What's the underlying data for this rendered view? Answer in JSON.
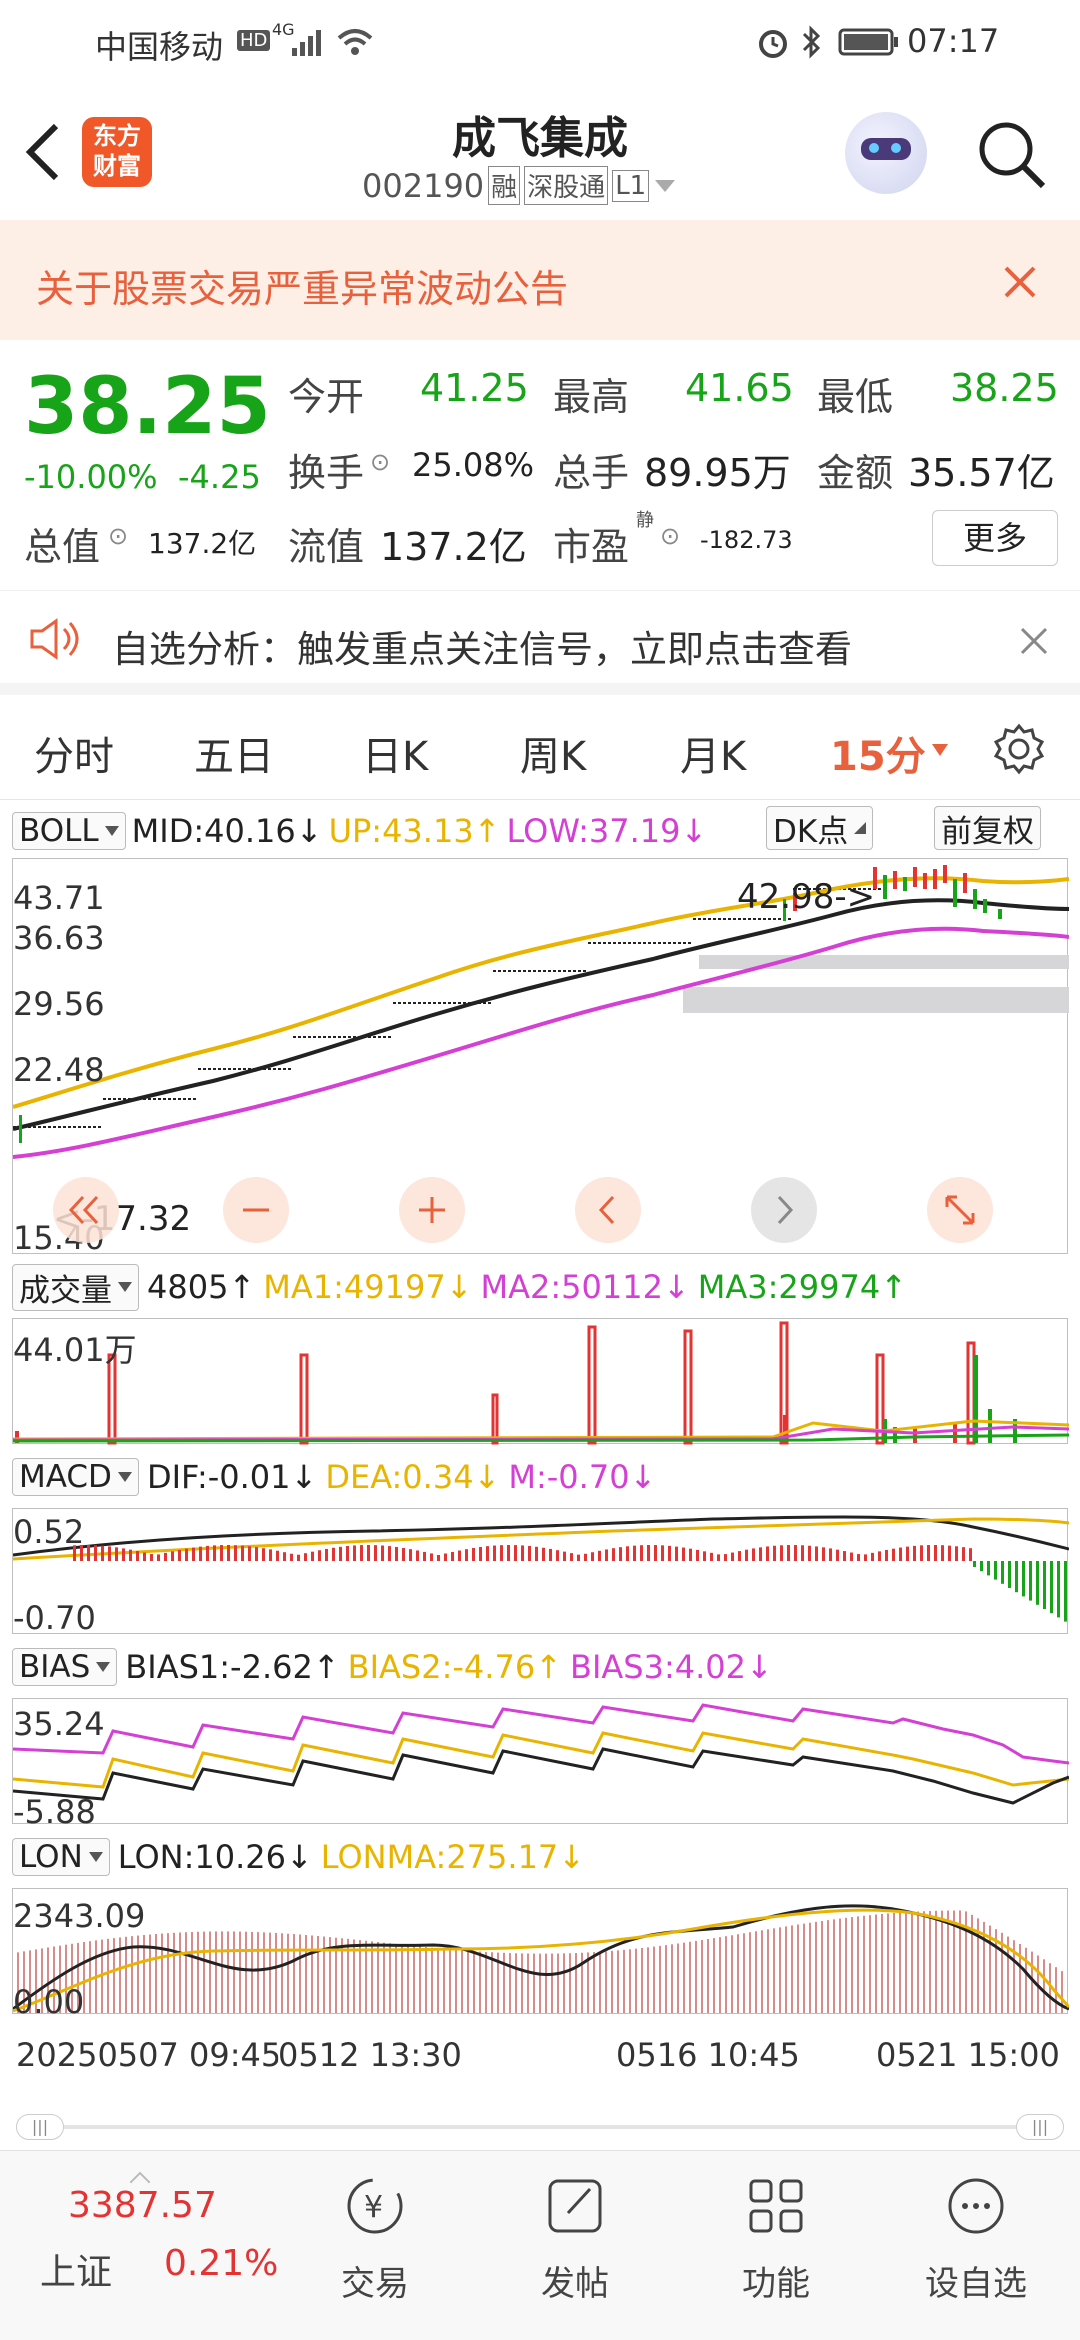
{
  "status_bar": {
    "carrier": "中国移动",
    "hd": "HD",
    "network": "4G",
    "time": "07:17"
  },
  "header": {
    "logo_text": "东方财富",
    "stock_name": "成飞集成",
    "stock_code": "002190",
    "tags": [
      "融",
      "深股通",
      "L1"
    ]
  },
  "notice": {
    "text": "关于股票交易严重异常波动公告"
  },
  "quote": {
    "price": "38.25",
    "change_pct": "-10.00%",
    "change": "-4.25",
    "open_label": "今开",
    "open": "41.25",
    "high_label": "最高",
    "high": "41.65",
    "low_label": "最低",
    "low": "38.25",
    "turnover_label": "换手",
    "turnover": "25.08%",
    "volume_label": "总手",
    "volume": "89.95万",
    "amount_label": "金额",
    "amount": "35.57亿",
    "market_cap_label": "总值",
    "market_cap": "137.2亿",
    "float_cap_label": "流值",
    "float_cap": "137.2亿",
    "pe_label": "市盈",
    "pe_sup": "静",
    "pe": "-182.73",
    "more_label": "更多"
  },
  "analysis": {
    "text": "自选分析：触发重点关注信号，立即点击查看"
  },
  "tabs": [
    "分时",
    "五日",
    "日K",
    "周K",
    "月K",
    "15分"
  ],
  "boll": {
    "name": "BOLL",
    "mid": "MID:40.16↓",
    "up": "UP:43.13↑",
    "low": "LOW:37.19↓",
    "dk": "DK点",
    "adjust": "前复权",
    "y_labels": [
      "43.71",
      "36.63",
      "29.56",
      "22.48",
      "15.40"
    ],
    "high_marker": "42.98->",
    "low_marker": "<-17.32"
  },
  "volume": {
    "name": "成交量",
    "value": "4805↑",
    "ma1": "MA1:49197↓",
    "ma2": "MA2:50112↓",
    "ma3": "MA3:29974↑",
    "y_label": "44.01万"
  },
  "macd": {
    "name": "MACD",
    "dif": "DIF:-0.01↓",
    "dea": "DEA:0.34↓",
    "m": "M:-0.70↓",
    "y_top": "0.52",
    "y_bottom": "-0.70"
  },
  "bias": {
    "name": "BIAS",
    "b1": "BIAS1:-2.62↑",
    "b2": "BIAS2:-4.76↑",
    "b3": "BIAS3:4.02↓",
    "y_top": "35.24",
    "y_bottom": "-5.88"
  },
  "lon": {
    "name": "LON",
    "lon": "LON:10.26↓",
    "lonma": "LONMA:275.17↓",
    "y_top": "2343.09",
    "y_bottom": "0.00"
  },
  "x_axis": [
    "20250507 09:45",
    "0512 13:30",
    "0516 10:45",
    "0521 15:00"
  ],
  "bottom_bar": {
    "index_value": "3387.57",
    "index_name": "上证",
    "index_change": "0.21%",
    "items": [
      "交易",
      "发帖",
      "功能",
      "设自选"
    ]
  },
  "colors": {
    "up": "#e33333",
    "down": "#18a418",
    "yellow": "#e8b400",
    "magenta": "#d43fd4",
    "accent": "#e8603c"
  }
}
